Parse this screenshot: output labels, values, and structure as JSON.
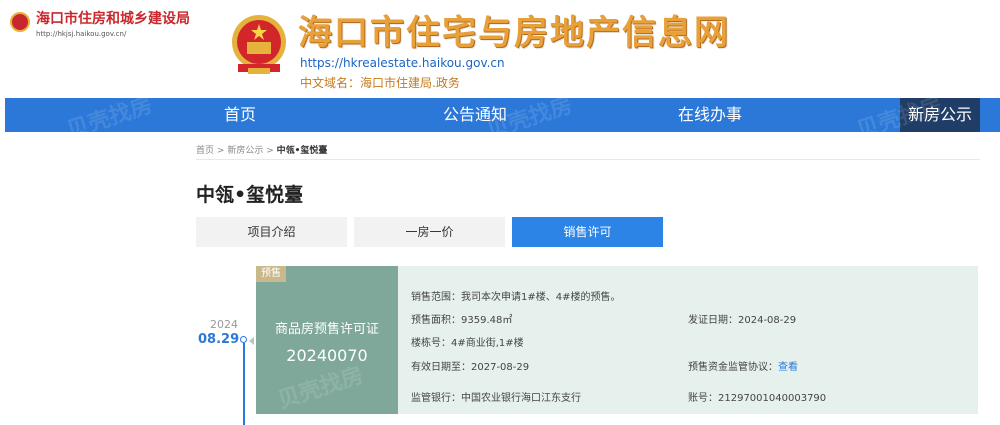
{
  "header": {
    "bureau_name": "海口市住房和城乡建设局",
    "bureau_url": "http://hkjsj.haikou.gov.cn/",
    "site_title": "海口市住宅与房地产信息网",
    "site_url": "https://hkrealestate.haikou.gov.cn",
    "site_cn_domain": "中文域名：海口市住建局.政务"
  },
  "nav": {
    "items": [
      {
        "label": "首页"
      },
      {
        "label": "公告通知"
      },
      {
        "label": "在线办事"
      },
      {
        "label": "新房公示"
      }
    ]
  },
  "breadcrumb": {
    "home": "首页",
    "sep1": ">",
    "section": "新房公示",
    "sep2": ">",
    "current": "中瓴•玺悦臺"
  },
  "project": {
    "title": "中瓴•玺悦臺"
  },
  "tabs": [
    {
      "label": "项目介绍"
    },
    {
      "label": "一房一价"
    },
    {
      "label": "销售许可"
    }
  ],
  "timeline": {
    "year": "2024",
    "date": "08.29"
  },
  "permit": {
    "tag": "预售",
    "type": "商品房预售许可证",
    "number": "20240070",
    "scope": "销售范围：我司本次申请1#楼、4#楼的预售。",
    "area": "预售面积：9359.48㎡",
    "issue_date": "发证日期：2024-08-29",
    "buildings": "楼栋号：4#商业街,1#楼",
    "valid_until": "有效日期至：2027-08-29",
    "escrow_label": "预售资金监管协议：",
    "escrow_link": "查看",
    "bank": "监管银行：中国农业银行海口江东支行",
    "account": "账号：21297001040003790"
  },
  "colors": {
    "nav_bg": "#2b78d8",
    "nav_active": "#1f3d66",
    "tab_active": "#2b84e6",
    "card_green": "#7fa89b",
    "card_light": "#e6f1ed",
    "title_orange": "#e8a13a"
  }
}
